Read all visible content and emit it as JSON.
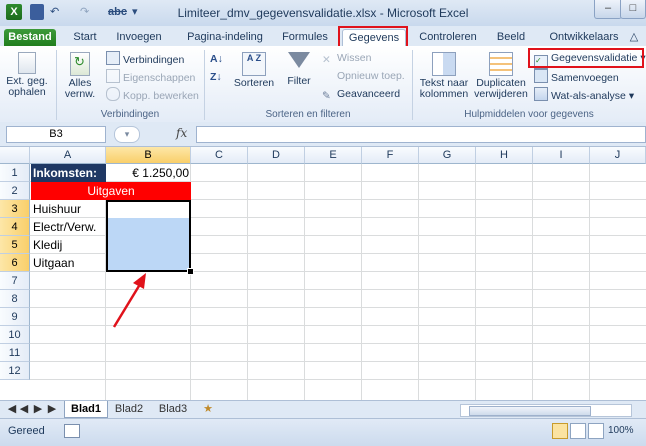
{
  "window": {
    "title": "Limiteer_dmv_gegevensvalidatie.xlsx - Microsoft Excel",
    "qat_undo": "↶",
    "qat_redo": "↷",
    "qat_spelling": "abc",
    "minimize": "–",
    "maximize": "□"
  },
  "tabs": [
    {
      "label": "Bestand"
    },
    {
      "label": "Start"
    },
    {
      "label": "Invoegen"
    },
    {
      "label": "Pagina-indeling"
    },
    {
      "label": "Formules"
    },
    {
      "label": "Gegevens"
    },
    {
      "label": "Controleren"
    },
    {
      "label": "Beeld"
    },
    {
      "label": "Ontwikkelaars"
    }
  ],
  "ribbon": {
    "ext_data_line1": "Ext. geg.",
    "ext_data_line2": "ophalen",
    "refresh_line1": "Alles",
    "refresh_line2": "vernw.",
    "connections": "Verbindingen",
    "properties": "Eigenschappen",
    "edit_links": "Kopp. bewerken",
    "group_connections": "Verbindingen",
    "sort_az": "A Z",
    "sort": "Sorteren",
    "filter": "Filter",
    "clear": "Wissen",
    "reapply": "Opnieuw toep.",
    "advanced": "Geavanceerd",
    "group_sort": "Sorteren en filteren",
    "text_to_cols_line1": "Tekst naar",
    "text_to_cols_line2": "kolommen",
    "duplicates_line1": "Duplicaten",
    "duplicates_line2": "verwijderen",
    "data_validation": "Gegevensvalidatie",
    "consolidate": "Samenvoegen",
    "what_if": "Wat-als-analyse",
    "group_tools": "Hulpmiddelen voor gegevens"
  },
  "formula_bar": {
    "name_box": "B3",
    "fx": "fx",
    "value": ""
  },
  "sheet": {
    "columns": [
      "A",
      "B",
      "C",
      "D",
      "E",
      "F",
      "G",
      "H",
      "I",
      "J"
    ],
    "rows": [
      "1",
      "2",
      "3",
      "4",
      "5",
      "6",
      "7",
      "8",
      "9",
      "10",
      "11",
      "12"
    ],
    "a1": "Inkomsten:",
    "b1": "€ 1.250,00",
    "a2": "Uitgaven",
    "a3": "Huishuur",
    "a4": "Electr/Verw.",
    "a5": "Kledij",
    "a6": "Uitgaan",
    "selected_range": "B3:B6",
    "header_fill": "#1f3864",
    "uitgaven_fill": "#ff0000",
    "selection_fill": "#bcd7f6"
  },
  "sheet_tabs": [
    {
      "label": "Blad1"
    },
    {
      "label": "Blad2"
    },
    {
      "label": "Blad3"
    }
  ],
  "status": {
    "ready": "Gereed",
    "zoom": "100%"
  },
  "colors": {
    "highlight": "#e0121b",
    "arrow": "#e0121b"
  }
}
